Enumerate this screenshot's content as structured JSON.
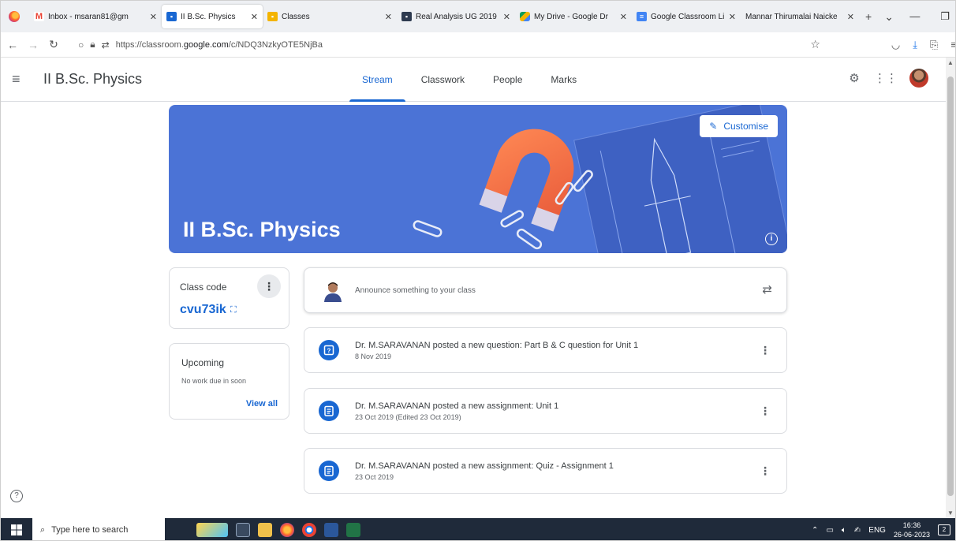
{
  "browser": {
    "tabs": [
      {
        "label": "Inbox - msaran81@gm",
        "favicon": "gmail-icon",
        "color": "#ea4335",
        "active": false
      },
      {
        "label": "II B.Sc. Physics",
        "favicon": "classroom-icon",
        "color": "#1967d2",
        "active": true
      },
      {
        "label": "Classes",
        "favicon": "classroom-icon",
        "color": "#f4b400",
        "active": false
      },
      {
        "label": "Real Analysis UG 2019",
        "favicon": "classroom-icon",
        "color": "#2d3a4f",
        "active": false
      },
      {
        "label": "My Drive - Google Dr",
        "favicon": "drive-icon",
        "color": "#34a853",
        "active": false
      },
      {
        "label": "Google Classroom Lin",
        "favicon": "docs-icon",
        "color": "#4285f4",
        "active": false
      },
      {
        "label": "Mannar Thirumalai Naicke",
        "favicon": "",
        "color": "#ffffff",
        "active": false
      }
    ],
    "url_prefix": "https://classroom.",
    "url_domain": "google.com",
    "url_path": "/c/NDQ3NzkyOTE5NjBa"
  },
  "classroom": {
    "class_title": "II B.Sc. Physics",
    "tabs": [
      "Stream",
      "Classwork",
      "People",
      "Marks"
    ],
    "active_tab": "Stream",
    "banner": {
      "title": "II B.Sc. Physics",
      "customise_label": "Customise",
      "color": "#4b73d6"
    },
    "class_code": {
      "label": "Class code",
      "value": "cvu73ik"
    },
    "upcoming": {
      "title": "Upcoming",
      "empty_text": "No work due in soon",
      "view_all_label": "View all"
    },
    "announce_placeholder": "Announce something to your class",
    "posts": [
      {
        "title": "Dr. M.SARAVANAN posted a new question: Part B & C question for Unit 1",
        "date": "8 Nov 2019",
        "icon": "question-icon"
      },
      {
        "title": "Dr. M.SARAVANAN posted a new assignment: Unit 1",
        "date": "23 Oct 2019 (Edited 23 Oct 2019)",
        "icon": "assignment-icon"
      },
      {
        "title": "Dr. M.SARAVANAN posted a new assignment: Quiz - Assignment 1",
        "date": "23 Oct 2019",
        "icon": "assignment-icon"
      }
    ],
    "accent": "#1967d2"
  },
  "taskbar": {
    "search_placeholder": "Type here to search",
    "language": "ENG",
    "time": "16:36",
    "date": "26-06-2023",
    "notifications": "2"
  }
}
